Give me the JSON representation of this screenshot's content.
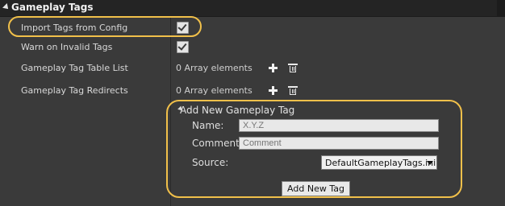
{
  "section": {
    "title": "Gameplay Tags"
  },
  "settings": [
    {
      "label": "Import Tags from Config",
      "checked": true
    },
    {
      "label": "Warn on Invalid Tags",
      "checked": true
    }
  ],
  "arrays": [
    {
      "label": "Gameplay Tag Table List",
      "value": "0 Array elements"
    },
    {
      "label": "Gameplay Tag Redirects",
      "value": "0 Array elements"
    }
  ],
  "add_tag_panel": {
    "title": "Add New Gameplay Tag",
    "name_label": "Name:",
    "name_placeholder": "X.Y.Z",
    "comment_label": "Comment:",
    "comment_placeholder": "Comment",
    "source_label": "Source:",
    "source_value": "DefaultGameplayTags.ini",
    "button_label": "Add New Tag"
  },
  "colors": {
    "highlight": "#f1c04a",
    "background": "#3a3a3a",
    "header": "#242424"
  },
  "icons": {
    "section_expand": "triangle-down-icon",
    "add": "plus-icon",
    "delete": "trash-icon"
  }
}
